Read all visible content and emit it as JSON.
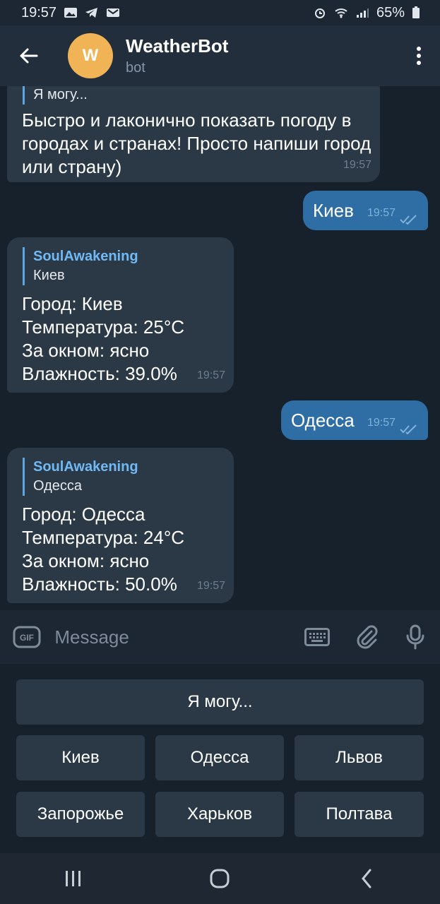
{
  "status_bar": {
    "time": "19:57",
    "battery": "65%"
  },
  "header": {
    "avatar_letter": "W",
    "title": "WeatherBot",
    "subtitle": "bot"
  },
  "messages": [
    {
      "reply_text": "Я могу...",
      "text": "Быстро и лаконично показать погоду в городах и странах! Просто напиши город или страну)",
      "time": "19:57"
    },
    {
      "text": "Киев",
      "time": "19:57"
    },
    {
      "reply_author": "SoulAwakening",
      "reply_text": "Киев",
      "lines": [
        "Город: Киев",
        "Температура: 25°C",
        "За окном: ясно",
        "Влажность: 39.0%"
      ],
      "time": "19:57"
    },
    {
      "text": "Одесса",
      "time": "19:57"
    },
    {
      "reply_author": "SoulAwakening",
      "reply_text": "Одесса",
      "lines": [
        "Город: Одесса",
        "Температура: 24°C",
        "За окном: ясно",
        "Влажность: 50.0%"
      ],
      "time": "19:57"
    }
  ],
  "composer": {
    "placeholder": "Message"
  },
  "keyboard": {
    "row1": [
      "Я могу..."
    ],
    "row2": [
      "Киев",
      "Одесса",
      "Львов"
    ],
    "row3": [
      "Запорожье",
      "Харьков",
      "Полтава"
    ]
  },
  "colors": {
    "accent": "#2f6ea5",
    "avatar": "#f0b355",
    "link": "#71b9f4"
  }
}
